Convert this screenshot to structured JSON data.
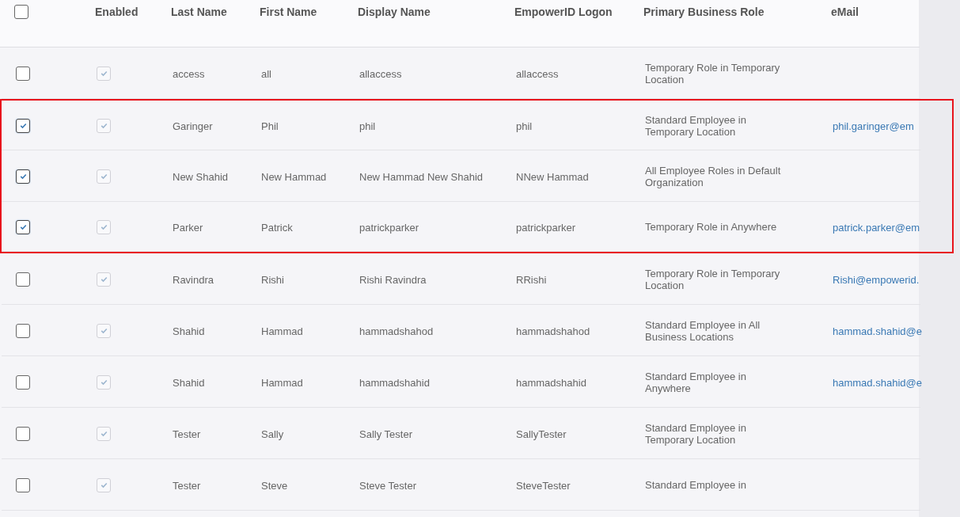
{
  "table": {
    "select_all": {
      "checked": false
    },
    "columns": [
      "Enabled",
      "Last Name",
      "First Name",
      "Display Name",
      "EmpowerID Logon",
      "Primary Business Role",
      "eMail"
    ],
    "rows": [
      {
        "selected": false,
        "enabled": true,
        "highlighted": false,
        "last_name": "access",
        "first_name": "all",
        "display_name": "allaccess",
        "logon": "allaccess",
        "role": "Temporary Role in Temporary Location"
      },
      {
        "selected": true,
        "enabled": true,
        "highlighted": true,
        "last_name": "Garinger",
        "first_name": "Phil",
        "display_name": "phil",
        "logon": "phil",
        "role": "Standard Employee in Temporary Location",
        "email": "phil.garinger@em"
      },
      {
        "selected": true,
        "enabled": true,
        "highlighted": true,
        "last_name": "New Shahid",
        "first_name": "New Hammad",
        "display_name": "New Hammad New Shahid",
        "logon": "NNew Hammad",
        "role": "All Employee Roles in Default Organization"
      },
      {
        "selected": true,
        "enabled": true,
        "highlighted": true,
        "last_name": "Parker",
        "first_name": "Patrick",
        "display_name": "patrickparker",
        "logon": "patrickparker",
        "role": "Temporary Role in Anywhere",
        "email": "patrick.parker@em"
      },
      {
        "selected": false,
        "enabled": true,
        "highlighted": false,
        "last_name": "Ravindra",
        "first_name": "Rishi",
        "display_name": "Rishi Ravindra",
        "logon": "RRishi",
        "role": "Temporary Role in Temporary Location",
        "email": "Rishi@empowerid."
      },
      {
        "selected": false,
        "enabled": true,
        "highlighted": false,
        "last_name": "Shahid",
        "first_name": "Hammad",
        "display_name": "hammadshahod",
        "logon": "hammadshahod",
        "role": "Standard Employee in All Business Locations",
        "email": "hammad.shahid@e"
      },
      {
        "selected": false,
        "enabled": true,
        "highlighted": false,
        "last_name": "Shahid",
        "first_name": "Hammad",
        "display_name": "hammadshahid",
        "logon": "hammadshahid",
        "role": "Standard Employee in Anywhere",
        "email": "hammad.shahid@e"
      },
      {
        "selected": false,
        "enabled": true,
        "highlighted": false,
        "last_name": "Tester",
        "first_name": "Sally",
        "display_name": "Sally Tester",
        "logon": "SallyTester",
        "role": "Standard Employee in Temporary Location"
      },
      {
        "selected": false,
        "enabled": true,
        "highlighted": false,
        "last_name": "Tester",
        "first_name": "Steve",
        "display_name": "Steve Tester",
        "logon": "SteveTester",
        "role": "Standard Employee in"
      }
    ]
  }
}
